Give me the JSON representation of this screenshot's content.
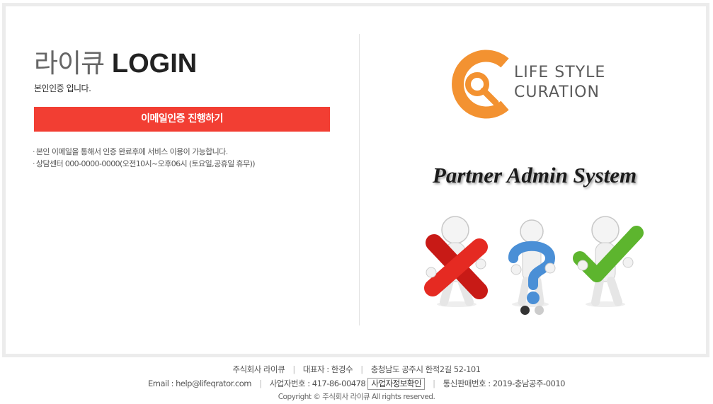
{
  "login": {
    "title_korean": "라이큐",
    "title_bold": "LOGIN",
    "subtitle": "본인인증 입니다.",
    "email_button": "이메일인증 진행하기",
    "notes": [
      "본인 이메일을 통해서 인증 완료후에 서비스 이용이 가능합니다.",
      "상담센터 000-0000-0000(오전10시~오후06시 (토요일,공휴일 휴무))"
    ]
  },
  "brand": {
    "logo_line1": "LIFE STYLE",
    "logo_line2": "CURATION",
    "headline": "Partner Admin System",
    "accent_color": "#f39231",
    "button_color": "#f23e33"
  },
  "slider": {
    "dots": [
      "active",
      "inactive"
    ]
  },
  "footer": {
    "company": "주식회사 라이큐",
    "ceo": "대표자 : 한경수",
    "address": "충청남도 공주시 한적2길 52-101",
    "email": "Email : help@lifeqrator.com",
    "biz_number": "사업자번호 : 417-86-00478",
    "biz_check_button": "사업자정보확인",
    "mail_order_number": "통신판매번호 : 2019-충남공주-0010",
    "copyright": "Copyright © 주식회사 라이큐 All rights reserved."
  }
}
